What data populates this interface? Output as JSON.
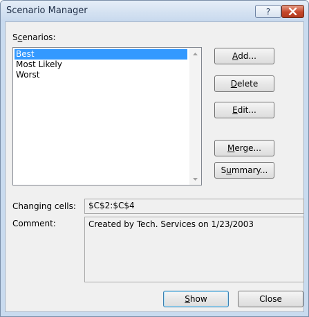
{
  "window": {
    "title": "Scenario Manager"
  },
  "scenarios": {
    "label_pre": "S",
    "label_acc": "c",
    "label_post": "enarios:",
    "items": [
      {
        "label": "Best",
        "selected": true
      },
      {
        "label": "Most Likely",
        "selected": false
      },
      {
        "label": "Worst",
        "selected": false
      }
    ]
  },
  "buttons": {
    "add": {
      "acc": "A",
      "rest": "dd..."
    },
    "delete": {
      "acc": "D",
      "rest": "elete"
    },
    "edit": {
      "acc": "E",
      "rest": "dit..."
    },
    "merge": {
      "acc": "M",
      "rest": "erge..."
    },
    "summary": {
      "pre": "S",
      "acc": "u",
      "rest": "mmary..."
    },
    "show": {
      "acc": "S",
      "rest": "how"
    },
    "close": "Close"
  },
  "details": {
    "changing_cells_label": "Changing cells:",
    "changing_cells_value": "$C$2:$C$4",
    "comment_label": "Comment:",
    "comment_value": "Created by Tech. Services on 1/23/2003"
  },
  "colors": {
    "selection": "#3399ff",
    "close_button": "#c5472b"
  },
  "icons": [
    "help-icon",
    "close-icon",
    "scroll-up-icon",
    "scroll-down-icon"
  ]
}
